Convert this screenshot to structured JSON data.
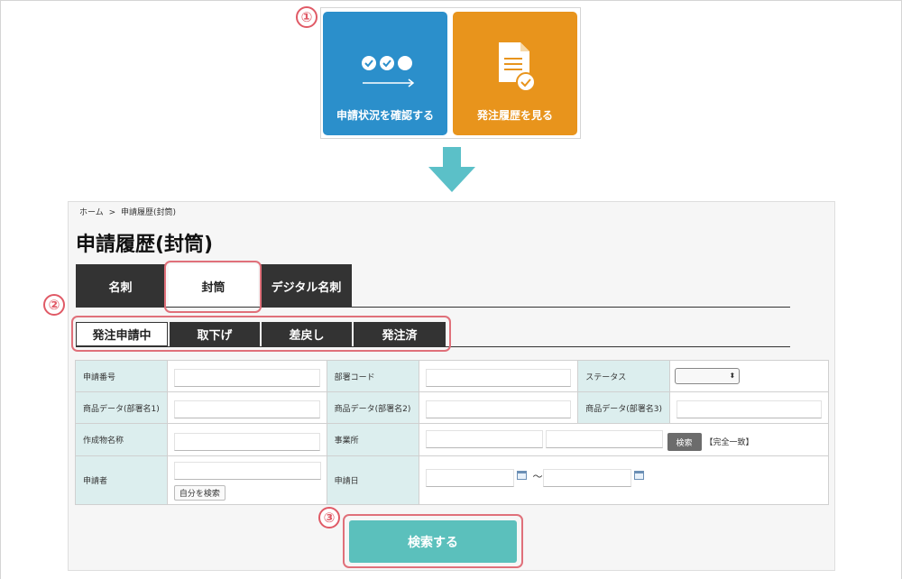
{
  "steps": {
    "one": "①",
    "two": "②",
    "three": "③"
  },
  "menu": {
    "tile1_label": "申請状況を確認する",
    "tile2_label": "発注履歴を見る",
    "tile1_color": "#2b8fcb",
    "tile2_color": "#e8941c"
  },
  "breadcrumb": {
    "home": "ホーム",
    "separator": ">",
    "current": "申請履歴(封筒)"
  },
  "page_title": "申請履歴(封筒)",
  "tabs": [
    {
      "label": "名刺",
      "active": false
    },
    {
      "label": "封筒",
      "active": true
    },
    {
      "label": "デジタル名刺",
      "active": false
    }
  ],
  "subtabs": [
    {
      "label": "発注申請中",
      "active": true
    },
    {
      "label": "取下げ",
      "active": false
    },
    {
      "label": "差戻し",
      "active": false
    },
    {
      "label": "発注済",
      "active": false
    }
  ],
  "form": {
    "application_number": "申請番号",
    "department_code": "部署コード",
    "status": "ステータス",
    "status_value": "",
    "product_data_1": "商品データ(部署名1)",
    "product_data_2": "商品データ(部署名2)",
    "product_data_3": "商品データ(部署名3)",
    "created_item_name": "作成物名称",
    "office": "事業所",
    "search_button": "検索",
    "exact_match": "【完全一致】",
    "applicant": "申請者",
    "self_search": "自分を検索",
    "application_date": "申請日",
    "tilde": "〜"
  },
  "submit_button": "検索する",
  "colors": {
    "accent_teal": "#5bc0bc",
    "label_bg": "#dceeee",
    "highlight": "#e0707a",
    "tab_dark": "#333333"
  },
  "icons": [
    "progress-dots-icon",
    "document-check-icon",
    "arrow-down-icon",
    "calendar-icon"
  ]
}
